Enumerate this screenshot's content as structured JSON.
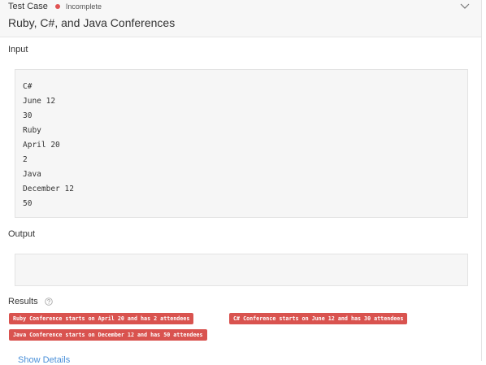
{
  "header": {
    "label": "Test Case",
    "status": "Incomplete",
    "status_color": "#e05353",
    "title": "Ruby, C#, and Java Conferences",
    "collapse_icon": "chevron-down-icon"
  },
  "input": {
    "label": "Input",
    "lines": [
      "C#",
      "June 12",
      "30",
      "Ruby",
      "April 20",
      "2",
      "Java",
      "December 12",
      "50"
    ]
  },
  "output": {
    "label": "Output",
    "lines": []
  },
  "results": {
    "label": "Results",
    "help_icon": "question-circle-icon",
    "items": [
      "Ruby Conference starts on April 20 and has 2 attendees",
      "C# Conference starts on June 12 and has 30 attendees",
      "Java Conference starts on December 12 and has 50 attendees"
    ],
    "badge_color": "#d9534f"
  },
  "footer": {
    "show_details": "Show Details"
  }
}
